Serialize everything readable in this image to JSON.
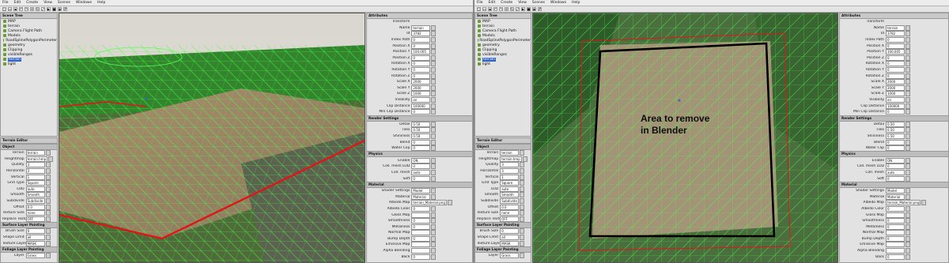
{
  "menu": [
    "File",
    "Edit",
    "Create",
    "View",
    "Scenes",
    "Windows",
    "Help"
  ],
  "left": {
    "scene_panel": {
      "title": "Scene Tree",
      "items": [
        {
          "label": "MAP",
          "icon": "globe-icon"
        },
        {
          "label": "terrain",
          "icon": "terrain-icon"
        },
        {
          "label": "Camera Flight Path",
          "icon": "camera-icon"
        },
        {
          "label": "Models",
          "icon": "folder-icon"
        },
        {
          "label": "RoadSplinePolygonPerimeter",
          "icon": "shape-icon"
        },
        {
          "label": "geometry",
          "icon": "shape-icon"
        },
        {
          "label": "Clipping",
          "icon": "folder-icon"
        },
        {
          "label": "visibleRanges",
          "icon": "shape-icon"
        },
        {
          "label": "terrain",
          "icon": "terrain-icon",
          "selected": true
        },
        {
          "label": "light",
          "icon": "light-icon"
        }
      ]
    },
    "bottom_panel": {
      "title": "Terrain Editor",
      "sections": [
        {
          "head": "Object",
          "rows": [
            {
              "label": "Terrain",
              "value": "terrain"
            },
            {
              "label": "Heightmap",
              "value": "terrain.hmp"
            },
            {
              "label": "Quality",
              "value": "3"
            },
            {
              "label": "Horizontal",
              "value": "3"
            },
            {
              "label": "Vertical",
              "value": "1"
            },
            {
              "label": "Grid Type",
              "value": "Square"
            },
            {
              "label": "LOD",
              "value": "auto"
            },
            {
              "label": "Smooth",
              "value": "Smooth"
            },
            {
              "label": "Subdivide",
              "value": "Subdivide"
            },
            {
              "label": "Offset",
              "value": "0.0"
            },
            {
              "label": "Texture Size",
              "value": "none"
            },
            {
              "label": "Replace Texture",
              "value": "OFF"
            }
          ]
        },
        {
          "head": "Surface Layer Painting",
          "rows": [
            {
              "label": "Brush Size",
              "value": "0"
            },
            {
              "label": "Shape Limit",
              "value": "all"
            },
            {
              "label": "Texture Layer",
              "value": "MASK"
            }
          ]
        },
        {
          "head": "Foliage Layer Painting",
          "rows": [
            {
              "label": "Layer",
              "value": "Grass"
            }
          ]
        }
      ]
    },
    "props_panel": {
      "title": "Attributes",
      "tab": "Transform",
      "rows": [
        {
          "label": "Name",
          "value": "terrain"
        },
        {
          "label": "Id",
          "value": "3782"
        },
        {
          "label": "Index Path",
          "value": "0"
        },
        {
          "label": "Position X",
          "value": "0"
        },
        {
          "label": "Position Y",
          "value": "100.005"
        },
        {
          "label": "Position Z",
          "value": "0"
        },
        {
          "label": "Rotation X",
          "value": "0"
        },
        {
          "label": "Rotation Y",
          "value": "0"
        },
        {
          "label": "Rotation Z",
          "value": "0"
        },
        {
          "label": "Scale X",
          "value": "2000"
        },
        {
          "label": "Scale Y",
          "value": "2000"
        },
        {
          "label": "Scale Z",
          "value": "1000"
        },
        {
          "label": "Visibility",
          "value": "on"
        },
        {
          "label": "Clip Distance",
          "value": "100000"
        },
        {
          "label": "Min Clip Distance",
          "value": "0"
        }
      ],
      "sections": [
        {
          "head": "Render Settings",
          "rows": [
            {
              "label": "Detail",
              "value": "0.50"
            },
            {
              "label": "Tiles",
              "value": "0.50"
            },
            {
              "label": "Shininess",
              "value": "0.50"
            },
            {
              "label": "Blend",
              "value": "0"
            },
            {
              "label": "Water Clip",
              "value": "0"
            }
          ]
        },
        {
          "head": "Physics",
          "rows": [
            {
              "label": "Enable",
              "value": "ON"
            },
            {
              "label": "Coll. mesh LOD",
              "value": "0"
            },
            {
              "label": "Coll. mesh",
              "value": "auto"
            },
            {
              "label": "Soft",
              "value": "0"
            }
          ]
        },
        {
          "head": "Material",
          "rows": [
            {
              "label": "Shader Settings",
              "value": "Model"
            },
            {
              "label": "Material",
              "value": "Material"
            },
            {
              "label": "Albedo Map",
              "value": "terrain_Material.png"
            },
            {
              "label": "Albedo Color",
              "value": "0"
            },
            {
              "label": "Gloss Map",
              "value": ""
            },
            {
              "label": "Smoothness",
              "value": "0"
            },
            {
              "label": "Metalness",
              "value": "0"
            },
            {
              "label": "Normal Map",
              "value": ""
            },
            {
              "label": "Bump Depth",
              "value": "0"
            },
            {
              "label": "Emissive Map",
              "value": ""
            },
            {
              "label": "Alpha Blending",
              "value": ""
            },
            {
              "label": "Back",
              "value": "0"
            }
          ]
        }
      ]
    }
  },
  "right": {
    "scene_panel": {
      "title": "Scene Tree",
      "items": [
        {
          "label": "MAP",
          "icon": "globe-icon"
        },
        {
          "label": "terrain",
          "icon": "terrain-icon"
        },
        {
          "label": "Camera Flight Path",
          "icon": "camera-icon"
        },
        {
          "label": "Models",
          "icon": "folder-icon"
        },
        {
          "label": "RoadSplinePolygonPerimeter",
          "icon": "shape-icon"
        },
        {
          "label": "geometry",
          "icon": "shape-icon"
        },
        {
          "label": "Clipping",
          "icon": "folder-icon"
        },
        {
          "label": "visibleRanges",
          "icon": "shape-icon"
        },
        {
          "label": "terrain",
          "icon": "terrain-icon",
          "selected": true
        },
        {
          "label": "light",
          "icon": "light-icon"
        }
      ]
    },
    "bottom_panel": {
      "title": "Terrain Editor",
      "sections": [
        {
          "head": "Object",
          "rows": [
            {
              "label": "Terrain",
              "value": "terrain"
            },
            {
              "label": "Heightmap",
              "value": "terrain.hmp"
            },
            {
              "label": "Quality",
              "value": "3"
            },
            {
              "label": "Horizontal",
              "value": "3"
            },
            {
              "label": "Vertical",
              "value": "1"
            },
            {
              "label": "Grid Type",
              "value": "Square"
            },
            {
              "label": "LOD",
              "value": "auto"
            },
            {
              "label": "Smooth",
              "value": "Smooth"
            },
            {
              "label": "Subdivide",
              "value": "Subdivide"
            },
            {
              "label": "Offset",
              "value": "0.0"
            },
            {
              "label": "Texture Size",
              "value": "none"
            },
            {
              "label": "Replace Texture",
              "value": "OFF"
            }
          ]
        },
        {
          "head": "Surface Layer Painting",
          "rows": [
            {
              "label": "Brush Size",
              "value": "0"
            },
            {
              "label": "Shape Limit",
              "value": "all"
            },
            {
              "label": "Texture Layer",
              "value": "MASK"
            }
          ]
        },
        {
          "head": "Foliage Layer Painting",
          "rows": [
            {
              "label": "Layer",
              "value": "Grass"
            }
          ]
        }
      ]
    },
    "props_panel": {
      "title": "Attributes",
      "tab": "Transform",
      "rows": [
        {
          "label": "Name",
          "value": "terrain"
        },
        {
          "label": "Id",
          "value": "3782"
        },
        {
          "label": "Index Path",
          "value": "0"
        },
        {
          "label": "Position X",
          "value": "0"
        },
        {
          "label": "Position Y",
          "value": "100.005"
        },
        {
          "label": "Position Z",
          "value": "0"
        },
        {
          "label": "Rotation X",
          "value": "0"
        },
        {
          "label": "Rotation Y",
          "value": "0"
        },
        {
          "label": "Rotation Z",
          "value": "0"
        },
        {
          "label": "Scale X",
          "value": "2000"
        },
        {
          "label": "Scale Y",
          "value": "2000"
        },
        {
          "label": "Scale Z",
          "value": "1000"
        },
        {
          "label": "Visibility",
          "value": "on"
        },
        {
          "label": "Clip Distance",
          "value": "100000"
        },
        {
          "label": "Min Clip Distance",
          "value": "0"
        }
      ],
      "sections": [
        {
          "head": "Render Settings",
          "rows": [
            {
              "label": "Detail",
              "value": "0.50"
            },
            {
              "label": "Tiles",
              "value": "0.50"
            },
            {
              "label": "Shininess",
              "value": "0.50"
            },
            {
              "label": "Blend",
              "value": "0"
            },
            {
              "label": "Water Clip",
              "value": "0"
            }
          ]
        },
        {
          "head": "Physics",
          "rows": [
            {
              "label": "Enable",
              "value": "ON"
            },
            {
              "label": "Coll. mesh LOD",
              "value": "0"
            },
            {
              "label": "Coll. mesh",
              "value": "auto"
            },
            {
              "label": "Soft",
              "value": "0"
            }
          ]
        },
        {
          "head": "Material",
          "rows": [
            {
              "label": "Shader Settings",
              "value": "Model"
            },
            {
              "label": "Material",
              "value": "Material"
            },
            {
              "label": "Albedo Map",
              "value": "terrain_Material.png"
            },
            {
              "label": "Albedo Color",
              "value": "0"
            },
            {
              "label": "Gloss Map",
              "value": ""
            },
            {
              "label": "Smoothness",
              "value": "0"
            },
            {
              "label": "Metalness",
              "value": "0"
            },
            {
              "label": "Normal Map",
              "value": ""
            },
            {
              "label": "Bump Depth",
              "value": "0"
            },
            {
              "label": "Emissive Map",
              "value": ""
            },
            {
              "label": "Alpha Blending",
              "value": ""
            },
            {
              "label": "Back",
              "value": "0"
            }
          ]
        }
      ]
    },
    "annotation": {
      "line1": "Area to remove",
      "line2": "in Blender"
    }
  },
  "colors": {
    "mesh": "#3cff3c",
    "boundary": "#e01616",
    "selection": "#3264c8",
    "removal_box": "#000000"
  }
}
